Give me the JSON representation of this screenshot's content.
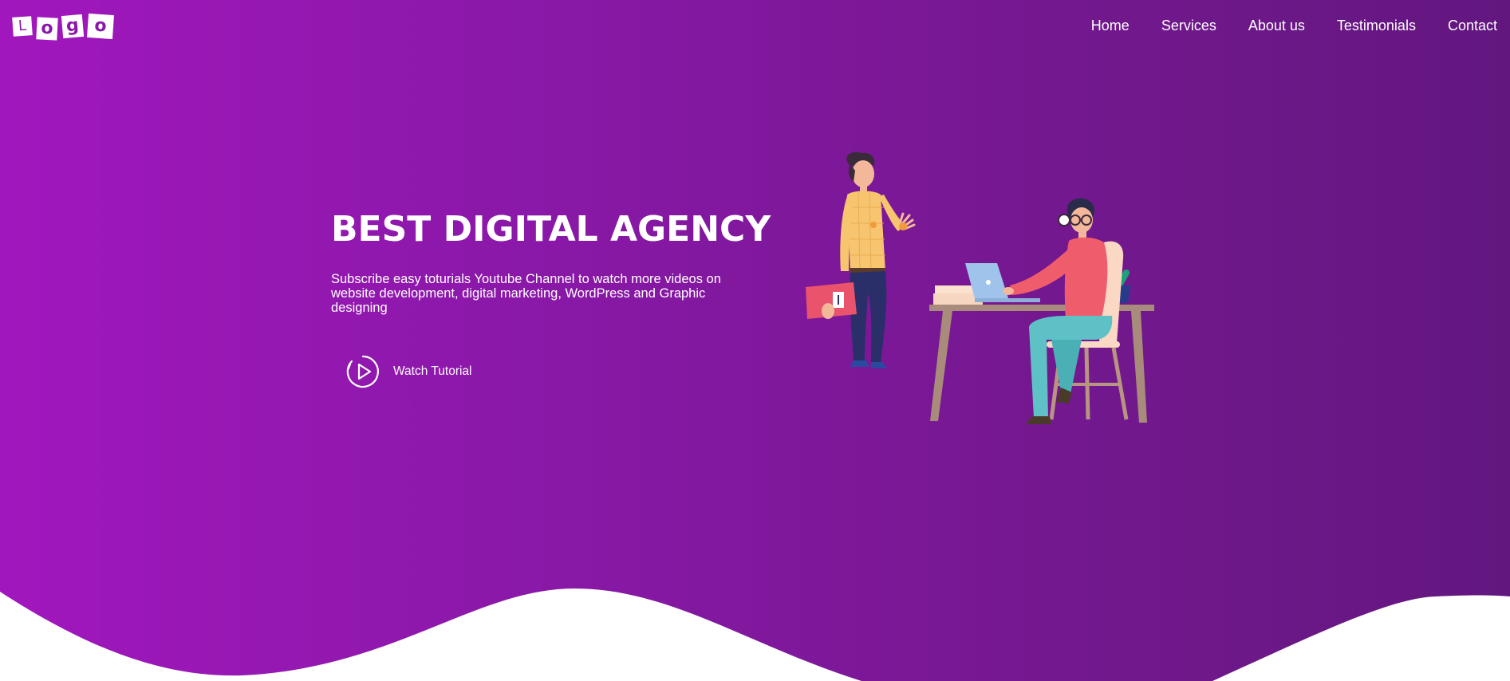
{
  "logo": {
    "letters": [
      "L",
      "o",
      "g",
      "o"
    ]
  },
  "nav": {
    "home": "Home",
    "services": "Services",
    "about": "About us",
    "testimonials": "Testimonials",
    "contact": "Contact"
  },
  "hero": {
    "title": "BEST DIGITAL AGENCY",
    "subtitle": "Subscribe easy toturials Youtube Channel to watch more videos on website development, digital marketing, WordPress and Graphic designing",
    "cta_label": "Watch Tutorial",
    "cta_icon": "play-circle-icon",
    "illustration": "office-people-illustration"
  },
  "colors": {
    "gradient_start": "#a117bd",
    "gradient_end": "#62177f",
    "text": "#ffffff",
    "wave": "#ffffff"
  }
}
